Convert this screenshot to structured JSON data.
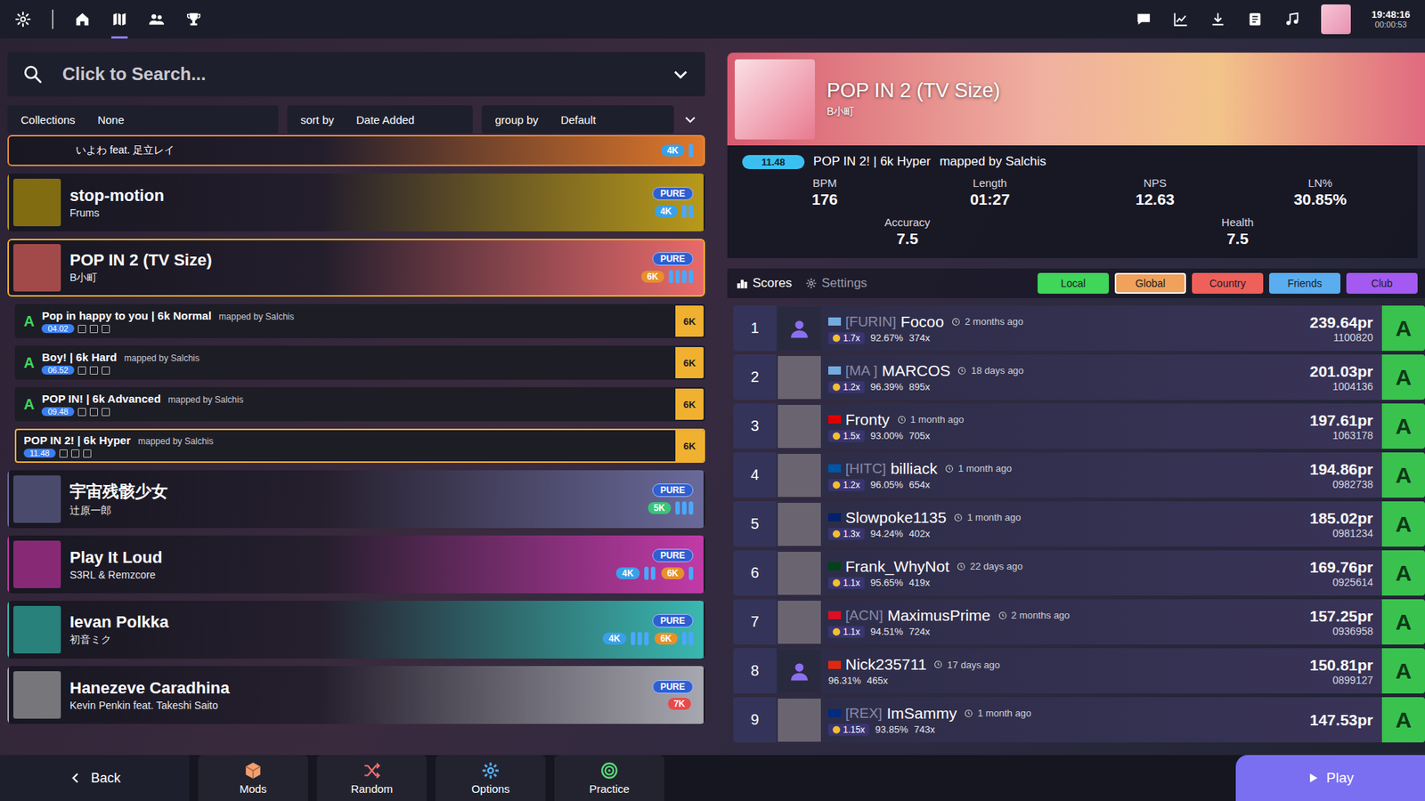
{
  "topbar": {
    "nav": [
      {
        "selected": false
      },
      {
        "selected": true
      },
      {
        "selected": false
      },
      {
        "selected": false
      }
    ],
    "clock": "19:48:16",
    "session": "00:00:53"
  },
  "search": {
    "placeholder": "Click to Search..."
  },
  "filters": [
    {
      "label": "Collections",
      "value": "None"
    },
    {
      "label": "sort by",
      "value": "Date Added"
    },
    {
      "label": "group by",
      "value": "Default"
    }
  ],
  "songs": [
    {
      "kind": "partial",
      "title": "",
      "artist": "いよわ feat. 足立レイ",
      "status": "",
      "color": "#e0782a",
      "selected": false,
      "expanded": false,
      "modes": [
        {
          "keys": "4K",
          "color": "#3aa0e8",
          "bars": 1
        }
      ],
      "difficulties": []
    },
    {
      "kind": "song",
      "title": "stop-motion",
      "artist": "Frums",
      "status": "PURE",
      "color": "#b89a1a",
      "selected": false,
      "expanded": false,
      "modes": [
        {
          "keys": "4K",
          "color": "#3aa0e8",
          "bars": 2
        }
      ],
      "difficulties": []
    },
    {
      "kind": "song",
      "title": "POP IN 2 (TV Size)",
      "artist": "B小町",
      "status": "PURE",
      "color": "#e86a6a",
      "selected": true,
      "expanded": true,
      "modes": [
        {
          "keys": "6K",
          "color": "#e8902a",
          "bars": 4
        }
      ],
      "difficulties": [
        {
          "name": "Pop in happy to you | 6k Normal",
          "mapper": "mapped by Salchis",
          "rating": "04.02",
          "keys": "6K",
          "grade": "A",
          "selected": false
        },
        {
          "name": "Boy! | 6k Hard",
          "mapper": "mapped by Salchis",
          "rating": "06.52",
          "keys": "6K",
          "grade": "A",
          "selected": false
        },
        {
          "name": "POP IN! | 6k Advanced",
          "mapper": "mapped by Salchis",
          "rating": "09.48",
          "keys": "6K",
          "grade": "A",
          "selected": false
        },
        {
          "name": "POP IN 2! | 6k Hyper",
          "mapper": "mapped by Salchis",
          "rating": "11.48",
          "keys": "6K",
          "grade": "",
          "selected": true
        }
      ]
    },
    {
      "kind": "song",
      "title": "宇宙残骸少女",
      "artist": "辻原一郎",
      "status": "PURE",
      "color": "#6a6a9a",
      "selected": false,
      "expanded": false,
      "modes": [
        {
          "keys": "5K",
          "color": "#3ac47a",
          "bars": 3
        }
      ],
      "difficulties": []
    },
    {
      "kind": "song",
      "title": "Play It Loud",
      "artist": "S3RL & Remzcore",
      "status": "PURE",
      "color": "#c23aa8",
      "selected": false,
      "expanded": false,
      "modes": [
        {
          "keys": "4K",
          "color": "#3aa0e8",
          "bars": 2
        },
        {
          "keys": "6K",
          "color": "#e8902a",
          "bars": 1
        }
      ],
      "difficulties": []
    },
    {
      "kind": "song",
      "title": "Ievan Polkka",
      "artist": "初音ミク",
      "status": "PURE",
      "color": "#3ab8b0",
      "selected": false,
      "expanded": false,
      "modes": [
        {
          "keys": "4K",
          "color": "#3aa0e8",
          "bars": 3
        },
        {
          "keys": "6K",
          "color": "#e8902a",
          "bars": 2
        }
      ],
      "difficulties": []
    },
    {
      "kind": "song",
      "title": "Hanezeve Caradhina",
      "artist": "Kevin Penkin feat. Takeshi Saito",
      "status": "PURE",
      "color": "#a8a8b0",
      "selected": false,
      "expanded": false,
      "modes": [
        {
          "keys": "7K",
          "color": "#e84a4a",
          "bars": 0
        }
      ],
      "difficulties": []
    }
  ],
  "selected_map": {
    "title": "POP IN 2 (TV Size)",
    "artist": "B小町",
    "rating": "11.48",
    "difficulty": "POP IN 2! | 6k Hyper",
    "mapper": "mapped by Salchis",
    "stats": [
      {
        "label": "BPM",
        "value": "176"
      },
      {
        "label": "Length",
        "value": "01:27"
      },
      {
        "label": "NPS",
        "value": "12.63"
      },
      {
        "label": "LN%",
        "value": "30.85%"
      },
      {
        "label": "Accuracy",
        "value": "7.5"
      },
      {
        "label": "Health",
        "value": "7.5"
      }
    ]
  },
  "score_tabs": [
    {
      "label": "Scores",
      "selected": true
    },
    {
      "label": "Settings",
      "selected": false
    }
  ],
  "leaderboards": [
    {
      "label": "Local",
      "color": "#3fd65a",
      "selected": false
    },
    {
      "label": "Global",
      "color": "#f0a25a",
      "selected": true
    },
    {
      "label": "Country",
      "color": "#f0605a",
      "selected": false
    },
    {
      "label": "Friends",
      "color": "#5aaef0",
      "selected": false
    },
    {
      "label": "Club",
      "color": "#a45af0",
      "selected": false
    }
  ],
  "scores": [
    {
      "rank": "1",
      "clan": "[FURIN]",
      "name": "Focoo",
      "ago": "2 months ago",
      "flag": "#74acdf",
      "mods": "1.7x",
      "accuracy": "92.67%",
      "combo": "374x",
      "pr": "239.64pr",
      "score": "1100820",
      "grade": "A",
      "avatar": "default"
    },
    {
      "rank": "2",
      "clan": "[MA  ]",
      "name": "MARCOS",
      "ago": "18 days ago",
      "flag": "#74acdf",
      "mods": "1.2x",
      "accuracy": "96.39%",
      "combo": "895x",
      "pr": "201.03pr",
      "score": "1004136",
      "grade": "A",
      "avatar": "photo"
    },
    {
      "rank": "3",
      "clan": "",
      "name": "Fronty",
      "ago": "1 month ago",
      "flag": "#dd0000",
      "mods": "1.5x",
      "accuracy": "93.00%",
      "combo": "705x",
      "pr": "197.61pr",
      "score": "1063178",
      "grade": "A",
      "avatar": "photo"
    },
    {
      "rank": "4",
      "clan": "[HITC]",
      "name": "billiack",
      "ago": "1 month ago",
      "flag": "#0055a4",
      "mods": "1.2x",
      "accuracy": "96.05%",
      "combo": "654x",
      "pr": "194.86pr",
      "score": "0982738",
      "grade": "A",
      "avatar": "photo"
    },
    {
      "rank": "5",
      "clan": "",
      "name": "Slowpoke1135",
      "ago": "1 month ago",
      "flag": "#012169",
      "mods": "1.3x",
      "accuracy": "94.24%",
      "combo": "402x",
      "pr": "185.02pr",
      "score": "0981234",
      "grade": "A",
      "avatar": "photo"
    },
    {
      "rank": "6",
      "clan": "",
      "name": "Frank_WhyNot",
      "ago": "22 days ago",
      "flag": "#01411c",
      "mods": "1.1x",
      "accuracy": "95.65%",
      "combo": "419x",
      "pr": "169.76pr",
      "score": "0925614",
      "grade": "A",
      "avatar": "photo"
    },
    {
      "rank": "7",
      "clan": "[ACN]",
      "name": "MaximusPrime",
      "ago": "2 months ago",
      "flag": "#d91023",
      "mods": "1.1x",
      "accuracy": "94.51%",
      "combo": "724x",
      "pr": "157.25pr",
      "score": "0936958",
      "grade": "A",
      "avatar": "photo"
    },
    {
      "rank": "8",
      "clan": "",
      "name": "Nick235711",
      "ago": "17 days ago",
      "flag": "#de2910",
      "mods": "",
      "accuracy": "96.31%",
      "combo": "465x",
      "pr": "150.81pr",
      "score": "0899127",
      "grade": "A",
      "avatar": "default"
    },
    {
      "rank": "9",
      "clan": "[REX]",
      "name": "ImSammy",
      "ago": "1 month ago",
      "flag": "#002b7f",
      "mods": "1.15x",
      "accuracy": "93.85%",
      "combo": "743x",
      "pr": "147.53pr",
      "score": "",
      "grade": "A",
      "avatar": "photo"
    }
  ],
  "bottom": {
    "back": "Back",
    "buttons": [
      "Mods",
      "Random",
      "Options",
      "Practice"
    ],
    "play": "Play"
  }
}
